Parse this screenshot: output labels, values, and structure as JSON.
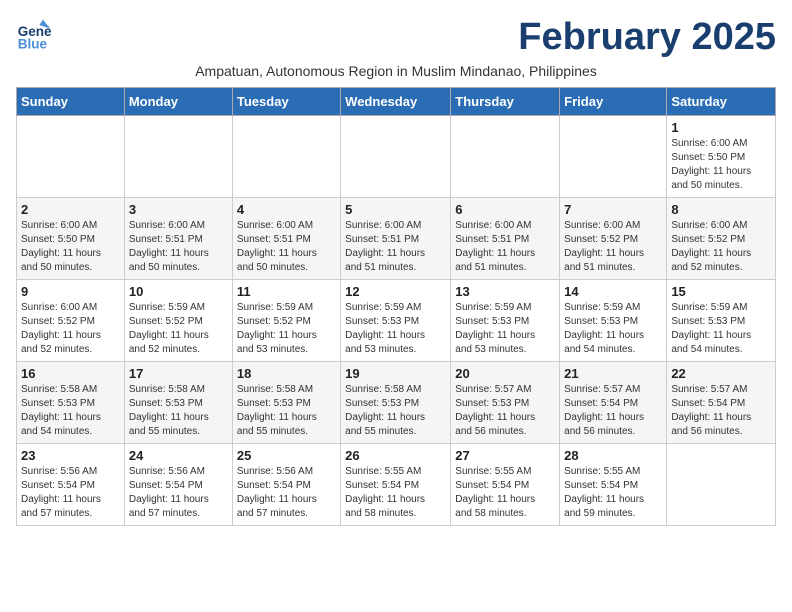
{
  "header": {
    "logo_general": "General",
    "logo_blue": "Blue",
    "month_title": "February 2025",
    "subtitle": "Ampatuan, Autonomous Region in Muslim Mindanao, Philippines"
  },
  "days_of_week": [
    "Sunday",
    "Monday",
    "Tuesday",
    "Wednesday",
    "Thursday",
    "Friday",
    "Saturday"
  ],
  "weeks": [
    {
      "cells": [
        {
          "day": "",
          "info": ""
        },
        {
          "day": "",
          "info": ""
        },
        {
          "day": "",
          "info": ""
        },
        {
          "day": "",
          "info": ""
        },
        {
          "day": "",
          "info": ""
        },
        {
          "day": "",
          "info": ""
        },
        {
          "day": "1",
          "info": "Sunrise: 6:00 AM\nSunset: 5:50 PM\nDaylight: 11 hours\nand 50 minutes."
        }
      ]
    },
    {
      "cells": [
        {
          "day": "2",
          "info": "Sunrise: 6:00 AM\nSunset: 5:50 PM\nDaylight: 11 hours\nand 50 minutes."
        },
        {
          "day": "3",
          "info": "Sunrise: 6:00 AM\nSunset: 5:51 PM\nDaylight: 11 hours\nand 50 minutes."
        },
        {
          "day": "4",
          "info": "Sunrise: 6:00 AM\nSunset: 5:51 PM\nDaylight: 11 hours\nand 50 minutes."
        },
        {
          "day": "5",
          "info": "Sunrise: 6:00 AM\nSunset: 5:51 PM\nDaylight: 11 hours\nand 51 minutes."
        },
        {
          "day": "6",
          "info": "Sunrise: 6:00 AM\nSunset: 5:51 PM\nDaylight: 11 hours\nand 51 minutes."
        },
        {
          "day": "7",
          "info": "Sunrise: 6:00 AM\nSunset: 5:52 PM\nDaylight: 11 hours\nand 51 minutes."
        },
        {
          "day": "8",
          "info": "Sunrise: 6:00 AM\nSunset: 5:52 PM\nDaylight: 11 hours\nand 52 minutes."
        }
      ]
    },
    {
      "cells": [
        {
          "day": "9",
          "info": "Sunrise: 6:00 AM\nSunset: 5:52 PM\nDaylight: 11 hours\nand 52 minutes."
        },
        {
          "day": "10",
          "info": "Sunrise: 5:59 AM\nSunset: 5:52 PM\nDaylight: 11 hours\nand 52 minutes."
        },
        {
          "day": "11",
          "info": "Sunrise: 5:59 AM\nSunset: 5:52 PM\nDaylight: 11 hours\nand 53 minutes."
        },
        {
          "day": "12",
          "info": "Sunrise: 5:59 AM\nSunset: 5:53 PM\nDaylight: 11 hours\nand 53 minutes."
        },
        {
          "day": "13",
          "info": "Sunrise: 5:59 AM\nSunset: 5:53 PM\nDaylight: 11 hours\nand 53 minutes."
        },
        {
          "day": "14",
          "info": "Sunrise: 5:59 AM\nSunset: 5:53 PM\nDaylight: 11 hours\nand 54 minutes."
        },
        {
          "day": "15",
          "info": "Sunrise: 5:59 AM\nSunset: 5:53 PM\nDaylight: 11 hours\nand 54 minutes."
        }
      ]
    },
    {
      "cells": [
        {
          "day": "16",
          "info": "Sunrise: 5:58 AM\nSunset: 5:53 PM\nDaylight: 11 hours\nand 54 minutes."
        },
        {
          "day": "17",
          "info": "Sunrise: 5:58 AM\nSunset: 5:53 PM\nDaylight: 11 hours\nand 55 minutes."
        },
        {
          "day": "18",
          "info": "Sunrise: 5:58 AM\nSunset: 5:53 PM\nDaylight: 11 hours\nand 55 minutes."
        },
        {
          "day": "19",
          "info": "Sunrise: 5:58 AM\nSunset: 5:53 PM\nDaylight: 11 hours\nand 55 minutes."
        },
        {
          "day": "20",
          "info": "Sunrise: 5:57 AM\nSunset: 5:53 PM\nDaylight: 11 hours\nand 56 minutes."
        },
        {
          "day": "21",
          "info": "Sunrise: 5:57 AM\nSunset: 5:54 PM\nDaylight: 11 hours\nand 56 minutes."
        },
        {
          "day": "22",
          "info": "Sunrise: 5:57 AM\nSunset: 5:54 PM\nDaylight: 11 hours\nand 56 minutes."
        }
      ]
    },
    {
      "cells": [
        {
          "day": "23",
          "info": "Sunrise: 5:56 AM\nSunset: 5:54 PM\nDaylight: 11 hours\nand 57 minutes."
        },
        {
          "day": "24",
          "info": "Sunrise: 5:56 AM\nSunset: 5:54 PM\nDaylight: 11 hours\nand 57 minutes."
        },
        {
          "day": "25",
          "info": "Sunrise: 5:56 AM\nSunset: 5:54 PM\nDaylight: 11 hours\nand 57 minutes."
        },
        {
          "day": "26",
          "info": "Sunrise: 5:55 AM\nSunset: 5:54 PM\nDaylight: 11 hours\nand 58 minutes."
        },
        {
          "day": "27",
          "info": "Sunrise: 5:55 AM\nSunset: 5:54 PM\nDaylight: 11 hours\nand 58 minutes."
        },
        {
          "day": "28",
          "info": "Sunrise: 5:55 AM\nSunset: 5:54 PM\nDaylight: 11 hours\nand 59 minutes."
        },
        {
          "day": "",
          "info": ""
        }
      ]
    }
  ]
}
